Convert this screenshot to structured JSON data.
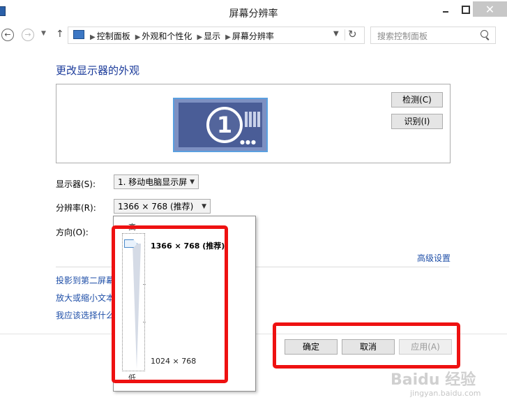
{
  "window": {
    "title": "屏幕分辨率"
  },
  "address": {
    "crumbs": [
      "控制面板",
      "外观和个性化",
      "显示",
      "屏幕分辨率"
    ],
    "search_placeholder": "搜索控制面板"
  },
  "main": {
    "heading": "更改显示器的外观",
    "detect_label": "检测(C)",
    "identify_label": "识别(I)",
    "monitor_number": "1",
    "display_label": "显示器(S):",
    "display_value": "1. 移动电脑显示屏",
    "resolution_label": "分辨率(R):",
    "resolution_value": "1366 × 768 (推荐)",
    "orientation_label": "方向(O):",
    "advanced_link": "高级设置",
    "links": [
      "投影到第二屏幕",
      "放大或缩小文本",
      "我应该选择什么"
    ]
  },
  "popup": {
    "high_label": "高",
    "low_label": "低",
    "max_resolution": "1366 × 768 (推荐)",
    "min_resolution": "1024 × 768",
    "slider_level": 1.0
  },
  "footer": {
    "ok": "确定",
    "cancel": "取消",
    "apply": "应用(A)"
  },
  "watermark": {
    "text": "Baidu 经验",
    "sub": "jingyan.baidu.com"
  },
  "colors": {
    "accent": "#1a3a9a",
    "highlight": "#ee1111",
    "link": "#1f4fa8"
  }
}
